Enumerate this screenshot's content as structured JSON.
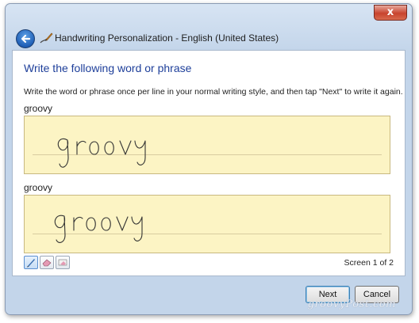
{
  "window": {
    "title": "Handwriting Personalization - English (United States)",
    "close_glyph": "x",
    "back_icon": "back-arrow-icon",
    "app_icon": "handwriting-pen-icon"
  },
  "main": {
    "heading": "Write the following word or phrase",
    "instruction": "Write the word or phrase once per line in your normal writing style, and then tap \"Next\" to write it again.",
    "entries": [
      {
        "label": "groovy",
        "ink": "groovy"
      },
      {
        "label": "groovy",
        "ink": "groovy"
      }
    ],
    "tools": [
      {
        "name": "pen-tool-icon",
        "active": true
      },
      {
        "name": "eraser-tool-icon",
        "active": false
      },
      {
        "name": "clear-tool-icon",
        "active": false
      }
    ],
    "screen_counter": "Screen 1 of 2"
  },
  "footer": {
    "next_label": "Next",
    "cancel_label": "Cancel"
  },
  "watermark": "groovyPost.com",
  "colors": {
    "heading": "#1e3f9a",
    "pad_fill": "#fcf4c4",
    "chrome": "#c3d5ea"
  }
}
